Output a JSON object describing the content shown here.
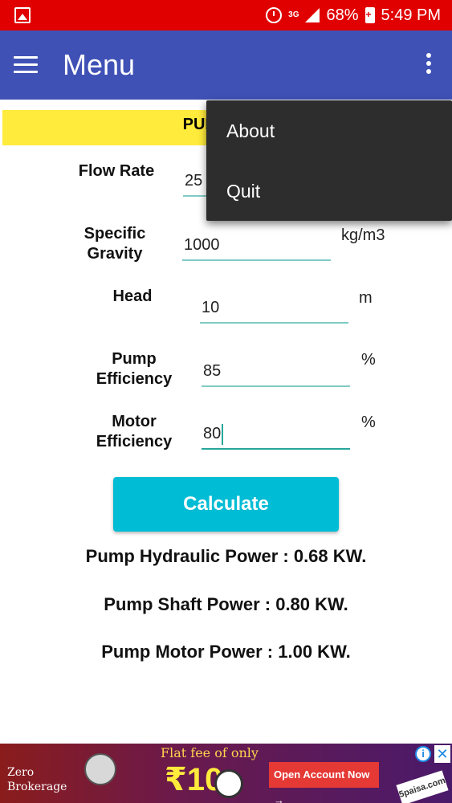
{
  "status_bar": {
    "battery": "68%",
    "time": "5:49 PM",
    "network": "3G",
    "icons": [
      "gallery-icon",
      "alarm-icon",
      "signal-icon",
      "battery-charging-icon"
    ]
  },
  "app_bar": {
    "title": "Menu",
    "nav_icon": "hamburger-icon",
    "overflow_icon": "more-vert-icon"
  },
  "header": {
    "title": "PUMP POW"
  },
  "form": {
    "flow_rate": {
      "label": "Flow Rate",
      "value": "25"
    },
    "specific_gravity": {
      "label_line1": "Specific",
      "label_line2": "Gravity",
      "value": "1000",
      "unit": "kg/m3"
    },
    "head": {
      "label": "Head",
      "value": "10",
      "unit": "m"
    },
    "pump_efficiency": {
      "label_line1": "Pump",
      "label_line2": "Efficiency",
      "value": "85",
      "unit": "%"
    },
    "motor_efficiency": {
      "label_line1": "Motor",
      "label_line2": "Efficiency",
      "value": "80",
      "unit": "%"
    }
  },
  "calculate_label": "Calculate",
  "results": {
    "hydraulic": "Pump Hydraulic Power : 0.68 KW.",
    "shaft": "Pump Shaft Power : 0.80 KW.",
    "motor": "Pump Motor Power : 1.00 KW."
  },
  "menu": {
    "items": [
      {
        "label": "About"
      },
      {
        "label": "Quit"
      }
    ]
  },
  "ad": {
    "zero_line1": "Zero",
    "zero_line2": "Brokerage",
    "flat_fee": "Flat fee of only",
    "price": "₹10",
    "cta": "Open Account Now →",
    "brand": "5paisa.com",
    "info": "i",
    "close": "✕"
  },
  "colors": {
    "status_bar": "#e00000",
    "app_bar": "#3f51b5",
    "header_strip": "#ffeb3b",
    "button": "#00bcd4",
    "field_underline": "#80cbc4",
    "menu_bg": "#2d2d2d"
  }
}
